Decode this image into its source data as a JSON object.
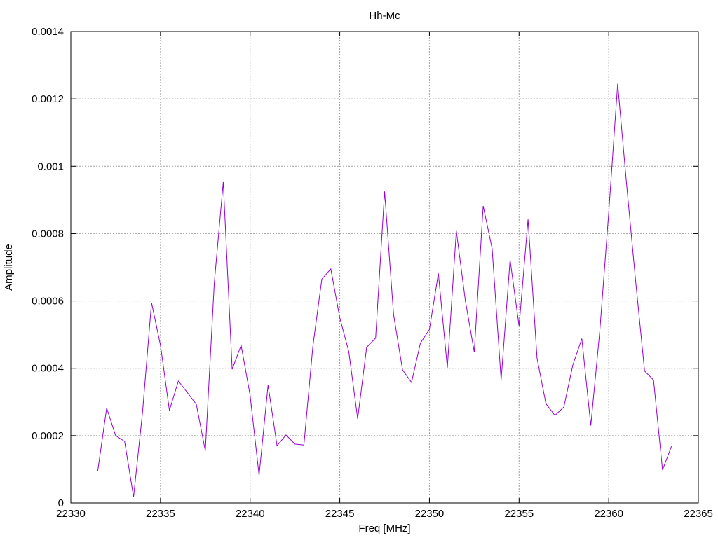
{
  "chart_data": {
    "type": "line",
    "title": "Hh-Mc",
    "xlabel": "Freq [MHz]",
    "ylabel": "Amplitude",
    "xlim": [
      22330,
      22365
    ],
    "ylim": [
      0,
      0.0014
    ],
    "x_ticks": [
      22330,
      22335,
      22340,
      22345,
      22350,
      22355,
      22360,
      22365
    ],
    "x_tick_labels": [
      "22330",
      "22335",
      "22340",
      "22345",
      "22350",
      "22355",
      "22360",
      "22365"
    ],
    "y_ticks": [
      0,
      0.0002,
      0.0004,
      0.0006,
      0.0008,
      0.001,
      0.0012,
      0.0014
    ],
    "y_tick_labels": [
      "0",
      "0.0002",
      "0.0004",
      "0.0006",
      "0.0008",
      "0.001",
      "0.0012",
      "0.0014"
    ],
    "grid": true,
    "line_color": "#9400d3",
    "series": [
      {
        "x": [
          22331.5,
          22332.0,
          22332.5,
          22333.0,
          22333.5,
          22334.0,
          22334.5,
          22335.0,
          22335.5,
          22336.0,
          22336.5,
          22337.0,
          22337.5,
          22338.0,
          22338.5,
          22339.0,
          22339.5,
          22340.0,
          22340.5,
          22341.0,
          22341.5,
          22342.0,
          22342.5,
          22343.0,
          22343.5,
          22344.0,
          22344.5,
          22345.0,
          22345.5,
          22346.0,
          22346.5,
          22347.0,
          22347.5,
          22348.0,
          22348.5,
          22349.0,
          22349.5,
          22350.0,
          22350.5,
          22351.0,
          22351.5,
          22352.0,
          22352.5,
          22353.0,
          22353.5,
          22354.0,
          22354.5,
          22355.0,
          22355.5,
          22356.0,
          22356.5,
          22357.0,
          22357.5,
          22358.0,
          22358.5,
          22359.0,
          22359.5,
          22360.0,
          22360.5,
          22361.0,
          22361.5,
          22362.0,
          22362.5,
          22363.0,
          22363.5
        ],
        "values": [
          9.5e-05,
          0.000282,
          0.0002,
          0.000183,
          1.8e-05,
          0.00027,
          0.000595,
          0.000468,
          0.000275,
          0.000362,
          0.000328,
          0.000293,
          0.000155,
          0.000653,
          0.000953,
          0.000397,
          0.000468,
          0.00032,
          8.2e-05,
          0.00035,
          0.00017,
          0.000202,
          0.000175,
          0.000172,
          0.000465,
          0.000665,
          0.000695,
          0.00055,
          0.00045,
          0.00025,
          0.000462,
          0.00049,
          0.000925,
          0.00056,
          0.000395,
          0.000358,
          0.000475,
          0.000515,
          0.000682,
          0.000402,
          0.000808,
          0.000602,
          0.000448,
          0.000882,
          0.000755,
          0.000365,
          0.000722,
          0.000525,
          0.000842,
          0.00043,
          0.000295,
          0.00026,
          0.000285,
          0.00041,
          0.000488,
          0.00023,
          0.00051,
          0.00086,
          0.001245,
          0.000945,
          0.00066,
          0.000392,
          0.000365,
          9.8e-05,
          0.000168
        ]
      }
    ]
  }
}
